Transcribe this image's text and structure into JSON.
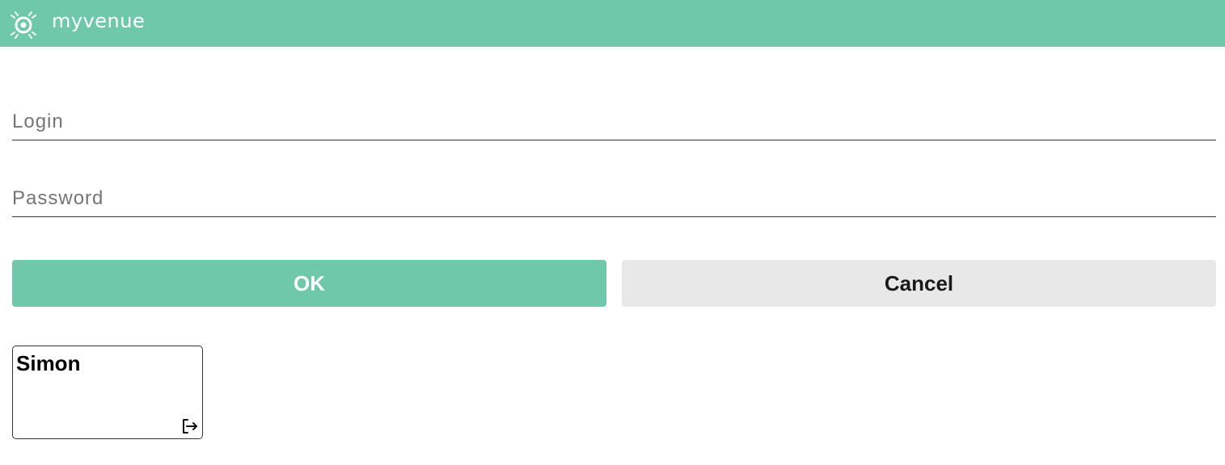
{
  "header": {
    "brand": "myvenue",
    "logo_icon": "venue-logo-icon",
    "background_color": "#6ec8a9"
  },
  "form": {
    "login": {
      "value": "",
      "placeholder": "Login"
    },
    "password": {
      "value": "",
      "placeholder": "Password"
    },
    "ok_label": "OK",
    "cancel_label": "Cancel"
  },
  "users": [
    {
      "name": "Simon",
      "logout_icon": "logout-icon"
    }
  ],
  "colors": {
    "accent": "#6ec8a9",
    "cancel_bg": "#e8e8e8",
    "border": "#333333"
  }
}
